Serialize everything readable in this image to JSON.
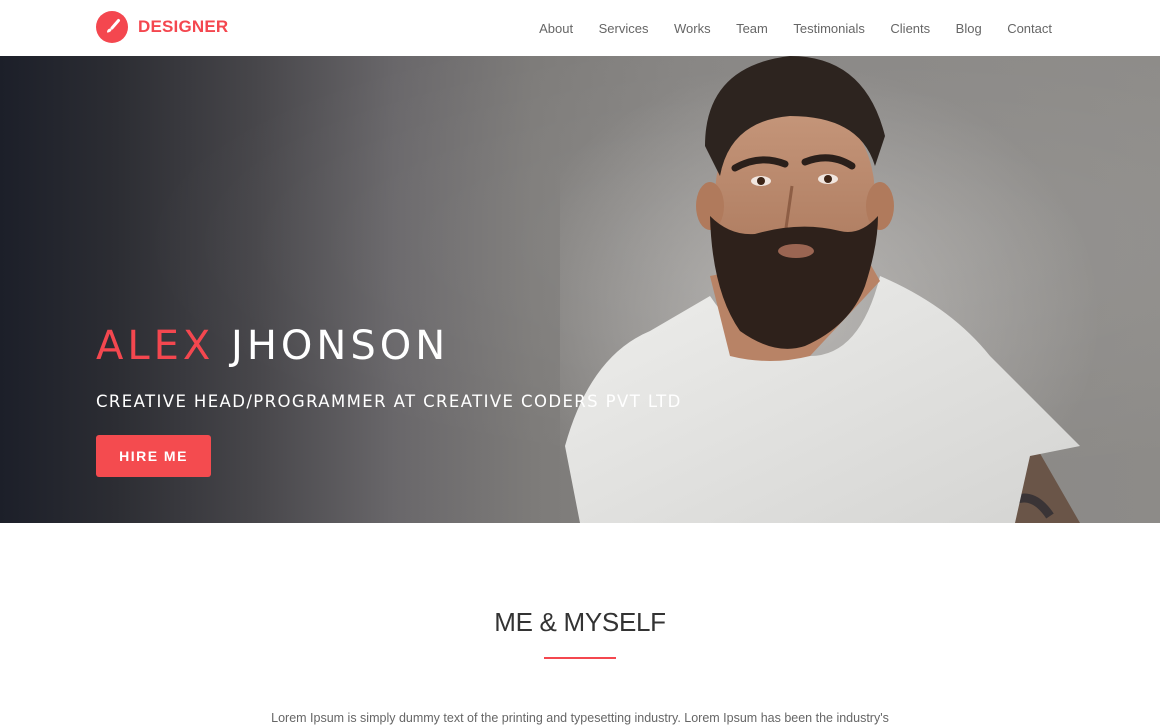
{
  "header": {
    "brand": "DESIGNER",
    "brand_color": "#f4474f",
    "nav": [
      {
        "label": "About"
      },
      {
        "label": "Services"
      },
      {
        "label": "Works"
      },
      {
        "label": "Team"
      },
      {
        "label": "Testimonials"
      },
      {
        "label": "Clients"
      },
      {
        "label": "Blog"
      },
      {
        "label": "Contact"
      }
    ]
  },
  "hero": {
    "first_name": "ALEX",
    "last_name": "JHONSON",
    "subtitle": "CREATIVE HEAD/PROGRAMMER AT CREATIVE CODERS PVT LTD",
    "cta": "HIRE ME",
    "image": "portrait-photo"
  },
  "about": {
    "title": "ME & MYSELF",
    "text": "Lorem Ipsum is simply dummy text of the printing and typesetting industry. Lorem Ipsum has been the industry's"
  }
}
